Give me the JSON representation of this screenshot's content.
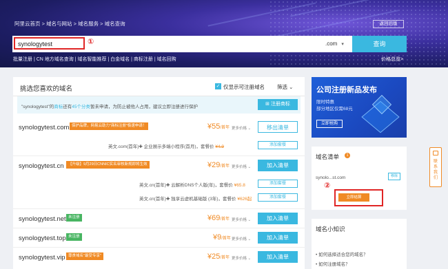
{
  "header": {
    "breadcrumb": "阿里云首页 > 域名与网站 > 域名服务 > 域名查询",
    "back_button": "返回旧版"
  },
  "search": {
    "value": "synologytest",
    "placeholder": "",
    "tld": ".com",
    "button": "查询",
    "annotation": "①"
  },
  "quicklinks": "批量注册 | CN 地方域名查询 | 域名智能推荐 | 白金域名 | 商标注册 | 域名回购",
  "price_link": "价格总览>",
  "main": {
    "title": "挑选您喜欢的域名",
    "checkbox_label": "仅显示可注册域名",
    "filter_label": "筛选",
    "notice": {
      "prefix": "\"synologytest\"的",
      "link": "商标",
      "mid": "还有",
      "count": "45个分类",
      "suffix": "暂未申请，为防止被他人占用，建议立即注册进行保护",
      "button": "注册商标"
    },
    "rows": [
      {
        "domain": "synologytest.com",
        "tag": "保护品牌，网易云助力\"商标注册\"极速申请！",
        "price": "55",
        "unit": "/首年",
        "more": "更多价格",
        "button": "移出清单",
        "sub1": "英文.com(首年)✚ 企业展示多端小程序(首月)，套餐价",
        "sub1_price": "¥4.9",
        "sub1_btn": "添加套餐"
      },
      {
        "domain": "synologytest.cn",
        "tag": "【升级】9月29日CNNIC实名审核新规即将生效",
        "price": "29",
        "unit": "/首年",
        "more": "更多价格",
        "button": "加入清单",
        "sub1": "英文.cn(首年)✚ 云解析DNS个人版(年)，套餐价",
        "sub1_price": "¥65.8",
        "sub1_btn": "添加套餐",
        "sub2": "英文.cn(首年)✚ 独享云虚机基础版 (3年)，套餐价",
        "sub2_price": "¥626起",
        "sub2_btn": "添加套餐"
      },
      {
        "domain": "synologytest.net",
        "tag": "未注册",
        "price": "69",
        "unit": "/首年",
        "more": "更多价格",
        "button": "加入清单"
      },
      {
        "domain": "synologytest.top",
        "tag": "未注册",
        "price": "9",
        "unit": "/首年",
        "more": "更多价格",
        "button": "加入清单"
      },
      {
        "domain": "synologytest.vip",
        "tag": "尊贵域名\"最受专享\"",
        "price": "25",
        "unit": "/首年",
        "more": "更多价格",
        "button": "加入清单"
      }
    ]
  },
  "promo": {
    "title": "公司注册新品发布",
    "line1": "限时特惠",
    "line2": "部分地区仅需68元",
    "button": "立即抢购"
  },
  "cart": {
    "title": "域名清单",
    "count": "1",
    "item": "synolo...st.com",
    "delete": "移除",
    "checkout": "立即结算",
    "annotation": "②"
  },
  "knowledge": {
    "title": "域名小知识",
    "q1": "• 如何选择适合您的域名？",
    "q2": "• 如何注册域名？"
  },
  "side_tab": {
    "text": "联系我们"
  }
}
